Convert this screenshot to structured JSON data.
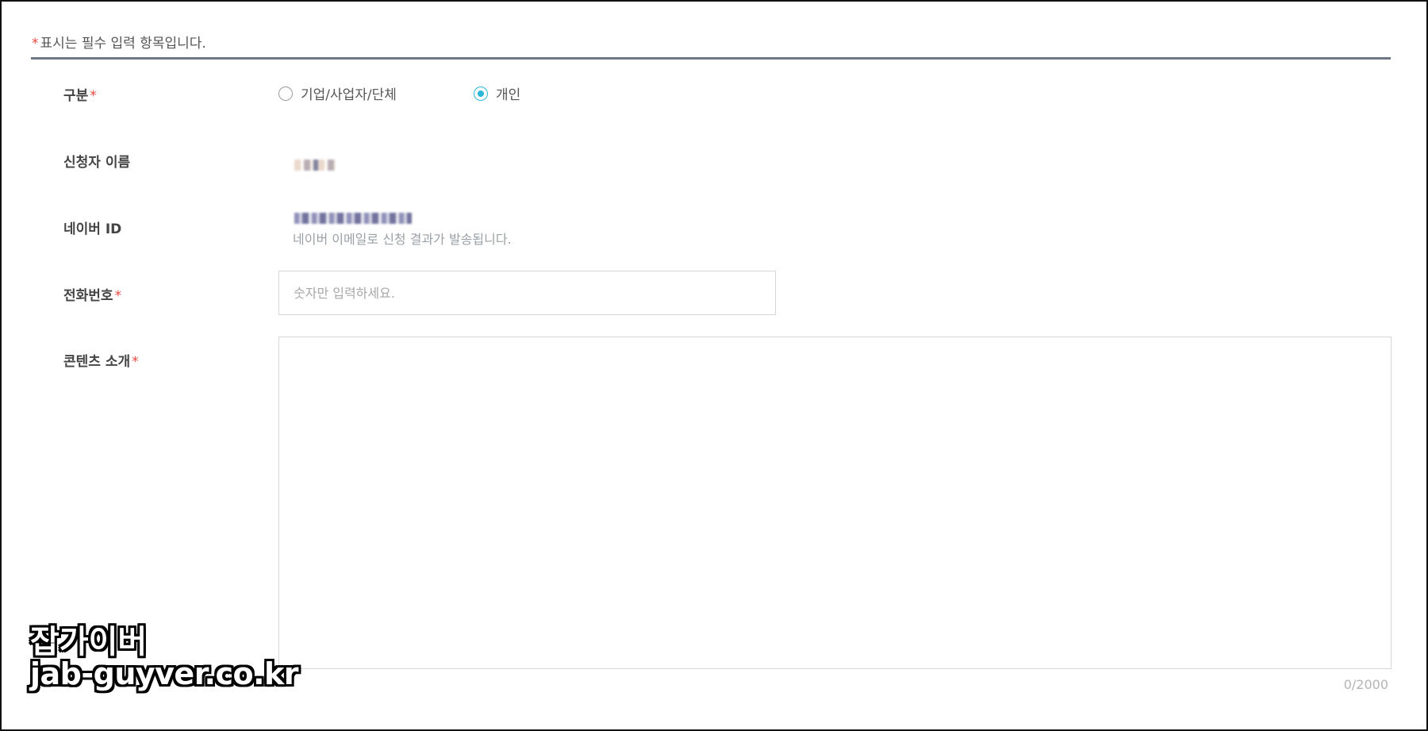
{
  "form": {
    "required_star": "*",
    "required_note": "표시는 필수 입력 항목입니다.",
    "division": {
      "label": "구분",
      "options": [
        {
          "label": "기업/사업자/단체",
          "selected": false
        },
        {
          "label": "개인",
          "selected": true
        }
      ]
    },
    "applicant_name": {
      "label": "신청자 이름"
    },
    "naver_id": {
      "label": "네이버 ID",
      "helper": "네이버 이메일로 신청 결과가 발송됩니다."
    },
    "phone": {
      "label": "전화번호",
      "placeholder": "숫자만 입력하세요.",
      "value": ""
    },
    "content_intro": {
      "label": "콘텐츠 소개",
      "value": "",
      "counter": "0/2000"
    }
  },
  "watermark": {
    "line1": "잡가이버",
    "line2": "jab-guyver.co.kr"
  },
  "colors": {
    "required": "#e8483f",
    "radio_accent": "#29b8d8",
    "rule": "#6f7684"
  }
}
